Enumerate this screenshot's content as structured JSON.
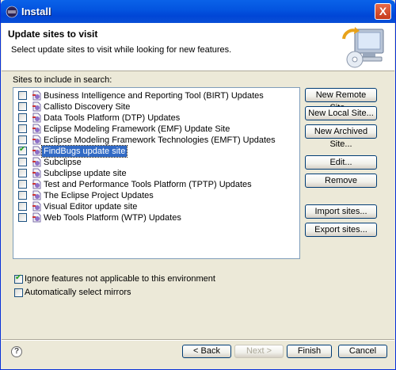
{
  "window": {
    "title": "Install",
    "close": "X"
  },
  "banner": {
    "title": "Update sites to visit",
    "description": "Select update sites to visit while looking for new features."
  },
  "sites_label": "Sites to include in search:",
  "sites": [
    {
      "label": "Business Intelligence and Reporting Tool (BIRT) Updates",
      "checked": false
    },
    {
      "label": "Callisto Discovery Site",
      "checked": false
    },
    {
      "label": "Data Tools Platform (DTP) Updates",
      "checked": false
    },
    {
      "label": "Eclipse Modeling Framework (EMF) Update Site",
      "checked": false
    },
    {
      "label": "Eclipse Modeling Framework Technologies (EMFT) Updates",
      "checked": false
    },
    {
      "label": "FindBugs update site",
      "checked": true,
      "selected": true
    },
    {
      "label": "Subclipse",
      "checked": false
    },
    {
      "label": "Subclipse update site",
      "checked": false
    },
    {
      "label": "Test and Performance Tools Platform (TPTP) Updates",
      "checked": false
    },
    {
      "label": "The Eclipse Project Updates",
      "checked": false
    },
    {
      "label": "Visual Editor update site",
      "checked": false
    },
    {
      "label": "Web Tools Platform (WTP) Updates",
      "checked": false
    }
  ],
  "side_buttons": {
    "new_remote": "New Remote Site...",
    "new_local": "New Local Site...",
    "new_archived": "New Archived Site...",
    "edit": "Edit...",
    "remove": "Remove",
    "import": "Import sites...",
    "export": "Export sites..."
  },
  "options": {
    "ignore_label": "Ignore features not applicable to this environment",
    "ignore_checked": true,
    "mirrors_label": "Automatically select mirrors",
    "mirrors_checked": false
  },
  "footer": {
    "help": "?",
    "back": "< Back",
    "next": "Next >",
    "finish": "Finish",
    "cancel": "Cancel"
  },
  "colors": {
    "titlebar": "#0054e3",
    "selection": "#316ac5",
    "window_bg": "#ece9d8"
  }
}
